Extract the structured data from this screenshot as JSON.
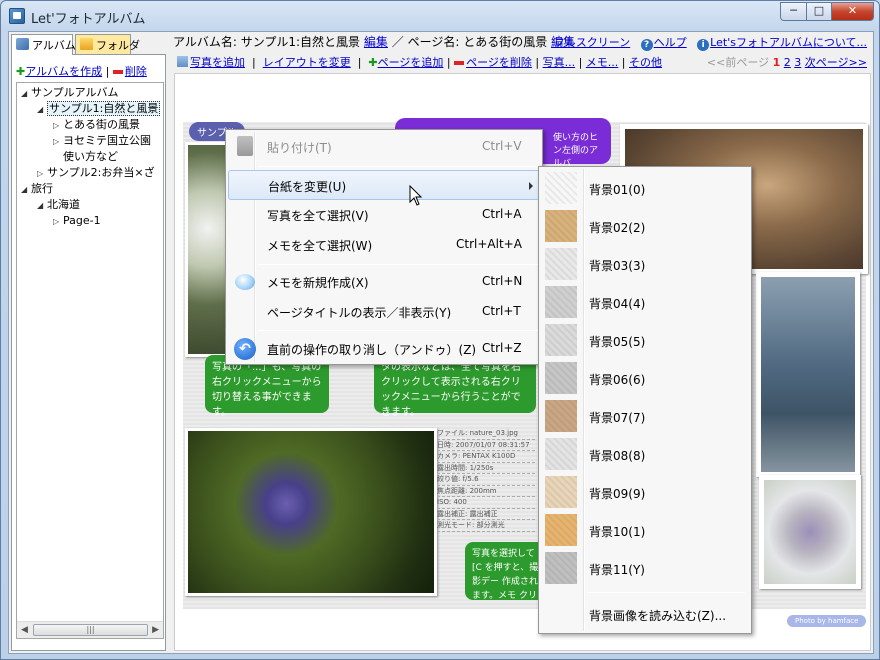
{
  "window": {
    "title": "Let'フォトアルバム",
    "min": "─",
    "max": "□",
    "close": "✕"
  },
  "left": {
    "tabs": [
      {
        "label": "アルバム"
      },
      {
        "label": "フォルダ"
      }
    ],
    "create_album": "アルバムを作成",
    "separator": "|",
    "delete": "削除",
    "tree": [
      {
        "label": "サンプルアルバム",
        "twisty": "◢"
      },
      {
        "label": "サンプル1:自然と風景",
        "twisty": "◢"
      },
      {
        "label": "とある街の風景",
        "twisty": "▷"
      },
      {
        "label": "ヨセミテ国立公園",
        "twisty": "▷"
      },
      {
        "label": "使い方など",
        "twisty": ""
      },
      {
        "label": "サンプル2:お弁当×ざ",
        "twisty": "▷"
      },
      {
        "label": "旅行",
        "twisty": "◢"
      },
      {
        "label": "北海道",
        "twisty": "◢"
      },
      {
        "label": "Page-1",
        "twisty": "▷"
      }
    ],
    "scroll_left": "◀",
    "scroll_right": "▶",
    "scroll_grip": "|||"
  },
  "info": {
    "album_label": "アルバム名: サンプル1:自然と風景",
    "edit1": "編集",
    "slash": "／",
    "page_label": "ページ名: とある街の風景",
    "edit2": "編集",
    "fullscreen": "フルスクリーン",
    "help": "ヘルプ",
    "about": "Let'sフォトアルバムについて..."
  },
  "toolbar": {
    "add_photo": "写真を追加",
    "change_layout": "レイアウトを変更",
    "add_page": "ページを追加",
    "delete_page": "ページを削除",
    "photo_menu": "写真...",
    "memo_menu": "メモ...",
    "other": "その他",
    "prev_page": "<<前ページ",
    "pages": [
      "1",
      "2",
      "3"
    ],
    "next_page": "次ページ>>"
  },
  "page": {
    "pill1": "サンプル",
    "pill2": "...",
    "note1": "写真の「...」も、写真の右クリックメニューから切り替える事ができます。",
    "note2": "タの表示などは、全て写真を右クリックして表示される右クリックメニューから行うことができます。",
    "note_right_top": "使い方のヒン左側のアルバ",
    "note3": "写真を選択して [C を押すと、撮影デー 作成されます。メモ クリックで編集でき",
    "exif": [
      "ファイル: nature_03.jpg",
      "日時: 2007/01/07 08:31:57",
      "カメラ: PENTAX K100D",
      "露出時間: 1/250s",
      "絞り値: f/5.6",
      "焦点距離: 200mm",
      "ISO: 400",
      "露出補正: 露出補正",
      "測光モード: 部分測光"
    ],
    "credit": "Photo by hamface"
  },
  "context_menu": [
    {
      "label": "貼り付け(T)",
      "shortcut": "Ctrl+V",
      "disabled": true,
      "icon": "paste-icon"
    },
    {
      "label": "台紙を変更(U)",
      "shortcut": "",
      "highlighted": true,
      "submenu": true
    },
    {
      "label": "写真を全て選択(V)",
      "shortcut": "Ctrl+A"
    },
    {
      "label": "メモを全て選択(W)",
      "shortcut": "Ctrl+Alt+A"
    },
    {
      "label": "メモを新規作成(X)",
      "shortcut": "Ctrl+N",
      "icon": "memo-icon"
    },
    {
      "label": "ページタイトルの表示／非表示(Y)",
      "shortcut": "Ctrl+T"
    },
    {
      "label": "直前の操作の取り消し（アンドゥ）(Z)",
      "shortcut": "Ctrl+Z",
      "icon": "undo-icon"
    }
  ],
  "submenu": [
    {
      "label": "背景01(0)",
      "swatch": "#f7f7f7"
    },
    {
      "label": "背景02(2)",
      "swatch": "#d8b27a"
    },
    {
      "label": "背景03(3)",
      "swatch": "#e8e8e8"
    },
    {
      "label": "背景04(4)",
      "swatch": "#cfcfcf"
    },
    {
      "label": "背景05(5)",
      "swatch": "#dadada"
    },
    {
      "label": "背景06(6)",
      "swatch": "#c6c6c6"
    },
    {
      "label": "背景07(7)",
      "swatch": "#c9a784"
    },
    {
      "label": "背景08(8)",
      "swatch": "#e3e3e3"
    },
    {
      "label": "背景09(9)",
      "swatch": "#e8d5b8"
    },
    {
      "label": "背景10(1)",
      "swatch": "#e7b46f"
    },
    {
      "label": "背景11(Y)",
      "swatch": "#bfbfbf"
    },
    {
      "label": "背景画像を読み込む(Z)...",
      "swatch": ""
    }
  ],
  "undo_glyph": "↶",
  "colors": {
    "link": "#0000cc",
    "note_green": "#2d9a2d",
    "highlight": "#dde9f8",
    "current_page": "#dd2222"
  }
}
